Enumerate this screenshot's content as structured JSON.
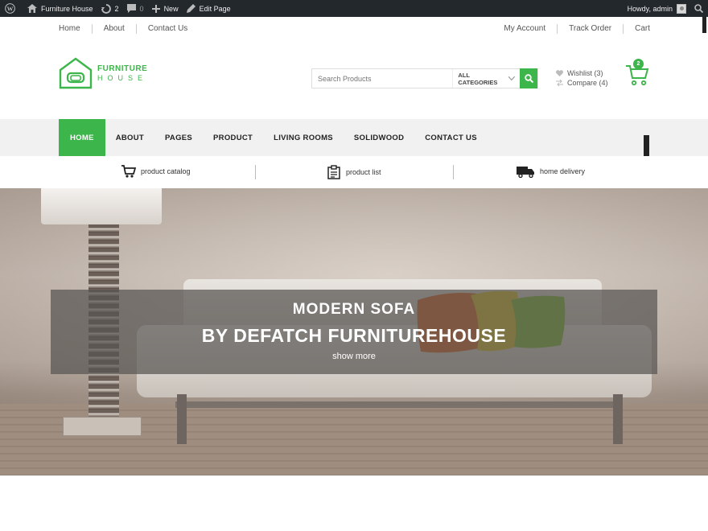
{
  "admin_bar": {
    "site_name": "Furniture House",
    "updates_count": "2",
    "comments_count": "0",
    "new_label": "New",
    "edit_label": "Edit Page",
    "greeting": "Howdy, admin"
  },
  "top_nav": {
    "left": [
      "Home",
      "About",
      "Contact Us"
    ],
    "right": [
      "My Account",
      "Track Order",
      "Cart"
    ]
  },
  "logo": {
    "line1": "FURNITURE",
    "line2": "HOUSE"
  },
  "search": {
    "placeholder": "Search Products",
    "category": "ALL CATEGORIES"
  },
  "header_links": {
    "wishlist": "Wishlist (3)",
    "compare": "Compare (4)"
  },
  "cart": {
    "count": "2"
  },
  "main_nav": [
    "HOME",
    "ABOUT",
    "PAGES",
    "PRODUCT",
    "LIVING ROOMS",
    "SOLIDWOOD",
    "CONTACT US"
  ],
  "features": [
    "product catalog",
    "product list",
    "home delivery"
  ],
  "hero": {
    "line1": "MODERN SOFA",
    "line2": "BY DEFATCH FURNITUREHOUSE",
    "cta": "show more"
  },
  "colors": {
    "accent": "#3cb54a",
    "admin_bar": "#23282d"
  },
  "icons": [
    "wordpress-icon",
    "home-icon",
    "updates-icon",
    "comments-icon",
    "plus-icon",
    "edit-icon",
    "search-icon",
    "heart-icon",
    "compare-icon",
    "cart-icon",
    "chevron-down-icon",
    "catalog-cart-icon",
    "list-icon",
    "delivery-truck-icon"
  ]
}
